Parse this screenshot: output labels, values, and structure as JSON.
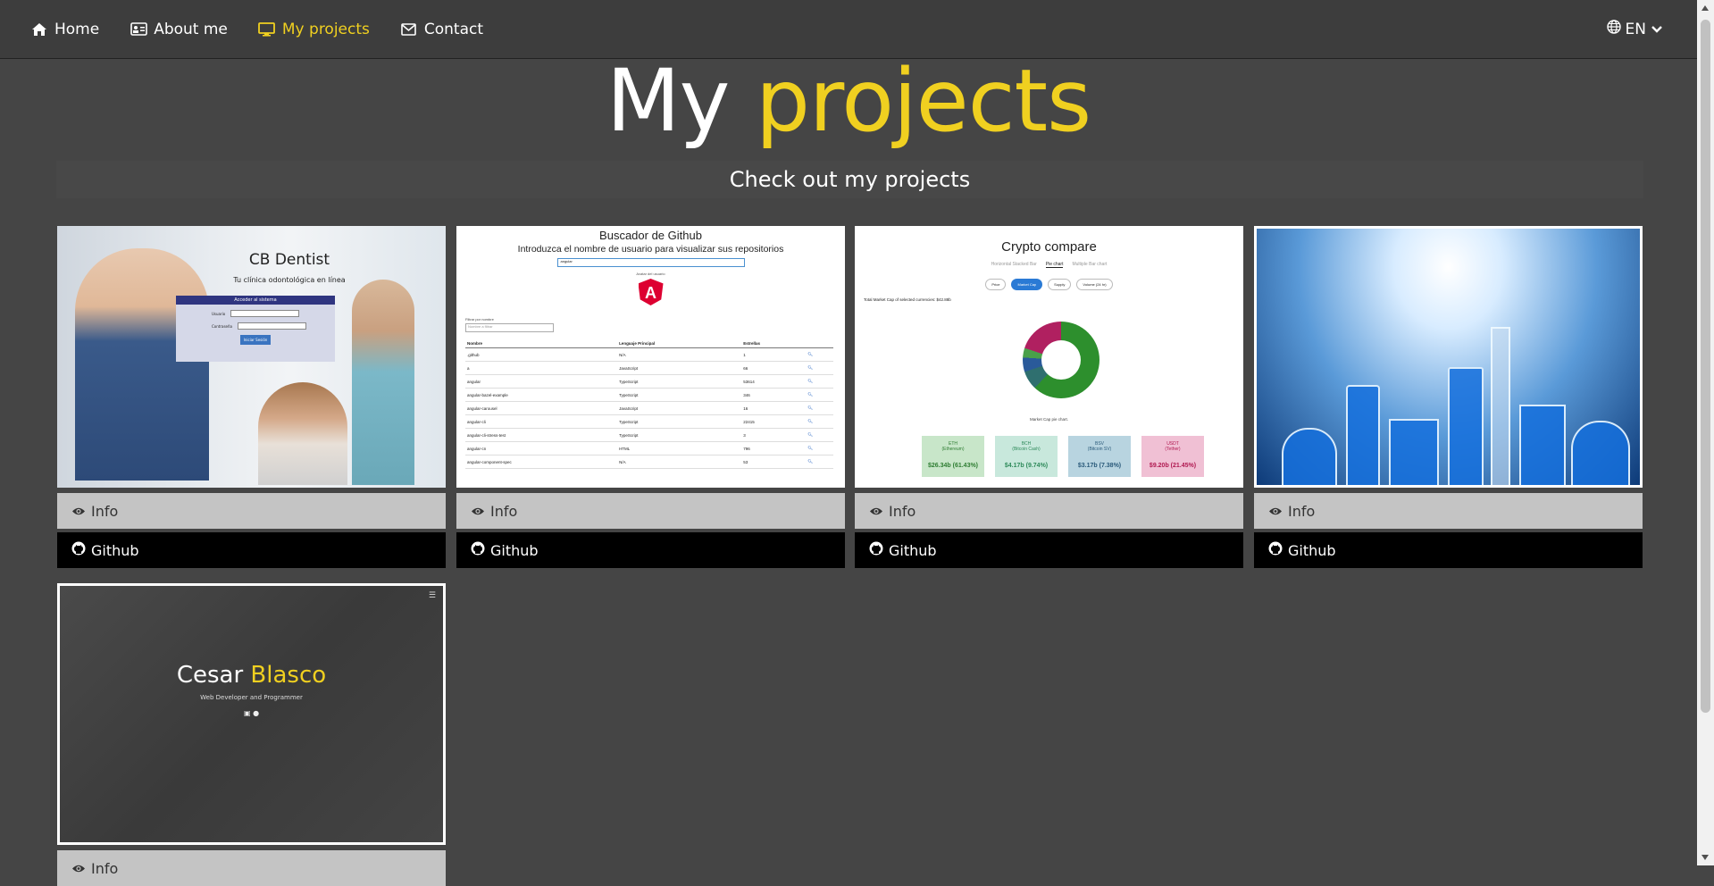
{
  "nav": {
    "items": [
      {
        "label": "Home",
        "icon": "home-icon"
      },
      {
        "label": "About me",
        "icon": "id-card-icon"
      },
      {
        "label": "My projects",
        "icon": "monitor-icon",
        "active": true
      },
      {
        "label": "Contact",
        "icon": "envelope-icon"
      }
    ],
    "lang": "EN",
    "active_color": "#f0d020"
  },
  "header": {
    "title_a": "My",
    "title_b": "projects",
    "subtitle": "Check out my projects"
  },
  "buttons": {
    "info": "Info",
    "github": "Github"
  },
  "projects": {
    "p1": {
      "title": "CB Dentist",
      "tagline": "Tu clínica odontológica en línea",
      "login_header": "Acceder al sistema",
      "user_label": "Usuario",
      "pass_label": "Contraseña",
      "login_button": "Iniciar Sesión"
    },
    "p2": {
      "title": "Buscador de Github",
      "subtitle": "Introduzca el nombre de usuario para visualizar sus repositorios",
      "input_value": "angular",
      "avatar_label": "Avatar del usuario",
      "filter_label": "Filtrar por nombre",
      "filter_placeholder": "Nombre a filtrar",
      "columns": [
        "Nombre",
        "Lenguaje Principal",
        "Estrellas"
      ],
      "rows": [
        [
          ".github",
          "N/A",
          "1"
        ],
        [
          "a",
          "JavaScript",
          "66"
        ],
        [
          "angular",
          "TypeScript",
          "53614"
        ],
        [
          "angular-bazel-example",
          "TypeScript",
          "346"
        ],
        [
          "angular-carousel",
          "JavaScript",
          "16"
        ],
        [
          "angular-cli",
          "TypeScript",
          "22415"
        ],
        [
          "angular-cli-stress-test",
          "TypeScript",
          "3"
        ],
        [
          "angular-cn",
          "HTML",
          "796"
        ],
        [
          "angular-component-spec",
          "N/A",
          "53"
        ]
      ]
    },
    "p3": {
      "title": "Crypto compare",
      "tabs": [
        "Horizontal Stacked Bar",
        "Pie chart",
        "Multiple Bar chart"
      ],
      "active_tab": "Pie chart",
      "pills": [
        "Price",
        "Market Cap",
        "Supply",
        "Volume (24 hr)"
      ],
      "active_pill": "Market Cap",
      "total_text": "Total Market Cap of selected currencies: $42.88b",
      "caption": "Market Cap pie chart.",
      "coins": [
        {
          "sym": "ETH",
          "name": "(Ethereum)",
          "value": "$26.34b",
          "pct": "(61.43%)",
          "bg": "#c8e6c9",
          "fg": "#2e7d32"
        },
        {
          "sym": "BCH",
          "name": "(Bitcoin Cash)",
          "value": "$4.17b",
          "pct": "(9.74%)",
          "bg": "#c8e8dc",
          "fg": "#2e8a5a"
        },
        {
          "sym": "BSV",
          "name": "(Bitcoin SV)",
          "value": "$3.17b",
          "pct": "(7.38%)",
          "bg": "#b8d4e0",
          "fg": "#2a5a7a"
        },
        {
          "sym": "USDT",
          "name": "(Tether)",
          "value": "$9.20b",
          "pct": "(21.45%)",
          "bg": "#f0c0d4",
          "fg": "#b01850"
        }
      ]
    },
    "p5": {
      "first": "Cesar",
      "last": "Blasco",
      "role": "Web Developer and Programmer"
    }
  }
}
